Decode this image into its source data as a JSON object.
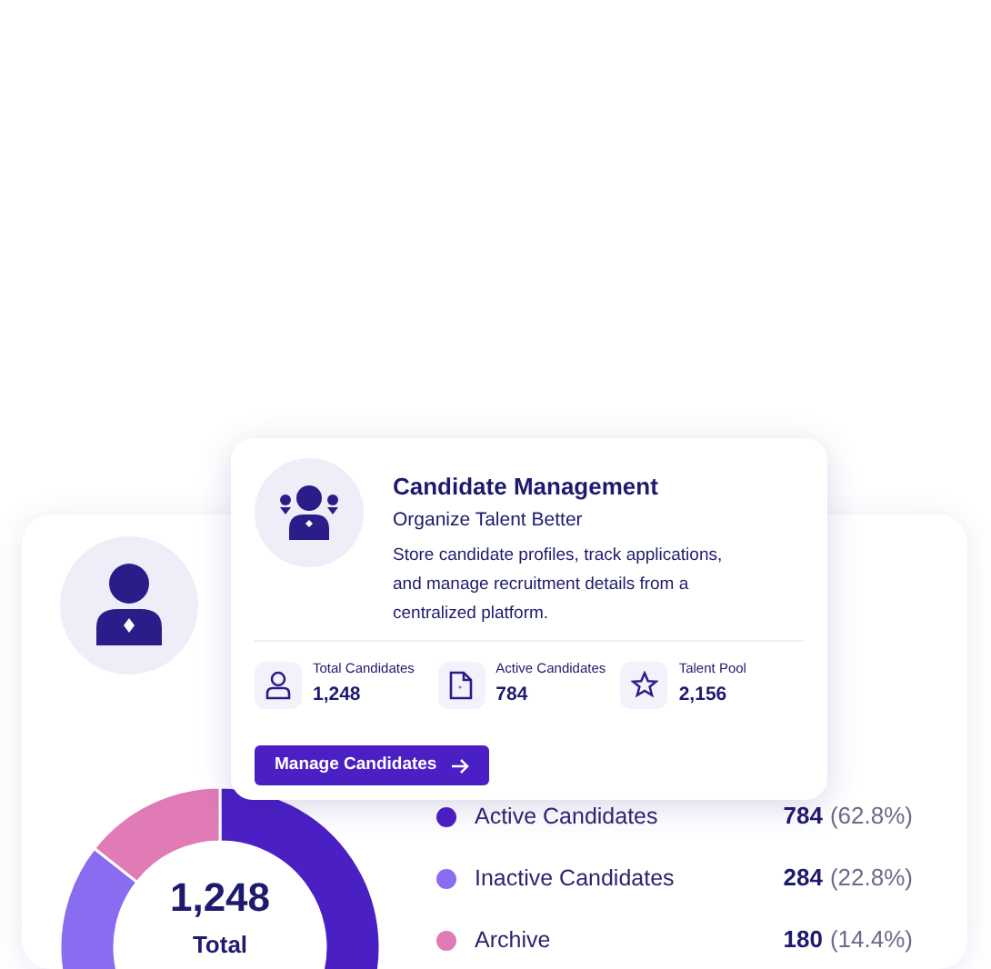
{
  "overview": {
    "chart_data": {
      "type": "donut",
      "categories": [
        "Active Candidates",
        "Inactive Candidates",
        "Archive"
      ],
      "values": [
        62.8,
        22.8,
        14.4
      ]
    },
    "center_value": "1,248",
    "center_label": "Total",
    "legend": [
      {
        "value": "784",
        "percent": "(62.8%)",
        "color": "#4a1fc4"
      },
      {
        "value": "284",
        "percent": "(22.8%)",
        "color": "#8a6cf0"
      },
      {
        "value": "180",
        "percent": "(14.4%)",
        "color": "#e07bb6"
      }
    ]
  },
  "feature_card": {
    "title": "Candidate Management",
    "subtitle": "Organize Talent Better",
    "description": "Store candidate profiles, track applications, and manage recruitment details from a centralized platform.",
    "stats": [
      {
        "kind": "person",
        "label": "Total Candidates",
        "value": "1,248"
      },
      {
        "kind": "document",
        "label": "Active Candidates",
        "value": "784"
      },
      {
        "kind": "star",
        "label": "Talent Pool",
        "value": "2,156"
      }
    ],
    "button": "Manage Candidates"
  }
}
